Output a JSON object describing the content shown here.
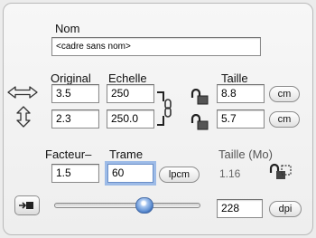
{
  "name": {
    "label": "Nom",
    "value": "<cadre sans nom>"
  },
  "headers": {
    "original": "Original",
    "echelle": "Echelle",
    "taille": "Taille"
  },
  "rows": [
    {
      "original": "3.5",
      "echelle": "250",
      "taille": "8.8",
      "unit": "cm"
    },
    {
      "original": "2.3",
      "echelle": "250.0",
      "taille": "5.7",
      "unit": "cm"
    }
  ],
  "factor": {
    "label": "Facteur–",
    "value": "1.5"
  },
  "trame": {
    "label": "Trame",
    "value": "60",
    "unit": "lpcm"
  },
  "size_mb": {
    "label": "Taille (Mo)",
    "value": "1.16"
  },
  "resolution": {
    "value": "228",
    "unit": "dpi",
    "slider_fraction": 0.62
  },
  "colors": {
    "focus": "#9dbbe7",
    "knob": "#5f8fd2"
  },
  "icons": [
    "horizontal-arrows-icon",
    "vertical-arrows-icon",
    "chain-link-icon",
    "lock-icon",
    "crop-frame-icon",
    "auto-fit-icon"
  ]
}
